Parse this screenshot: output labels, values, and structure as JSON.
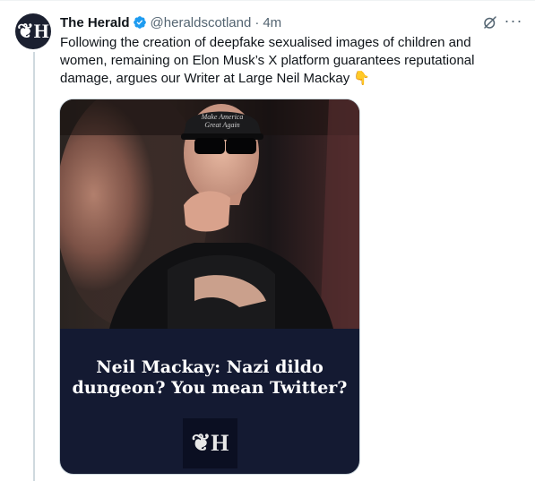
{
  "tweet": {
    "display_name": "The Herald",
    "handle": "@heraldscotland",
    "separator": "·",
    "time": "4m",
    "text": "Following the creation of deepfake sexualised images of children and women, remaining on Elon Musk’s X platform guarantees reputational damage, argues our Writer at Large Neil Mackay 👇",
    "avatar_text": "❦H",
    "more_label": "···",
    "icons": [
      "verified-badge-icon",
      "grok-icon",
      "more-icon"
    ]
  },
  "card": {
    "headline": "Neil Mackay: Nazi dildo dungeon? You mean Twitter?",
    "logo_text": "❦H",
    "cap_text": "Make America Great Again"
  },
  "colors": {
    "verified": "#1d9bf0",
    "secondary_text": "#536471",
    "card_bottom": "#141a32"
  }
}
